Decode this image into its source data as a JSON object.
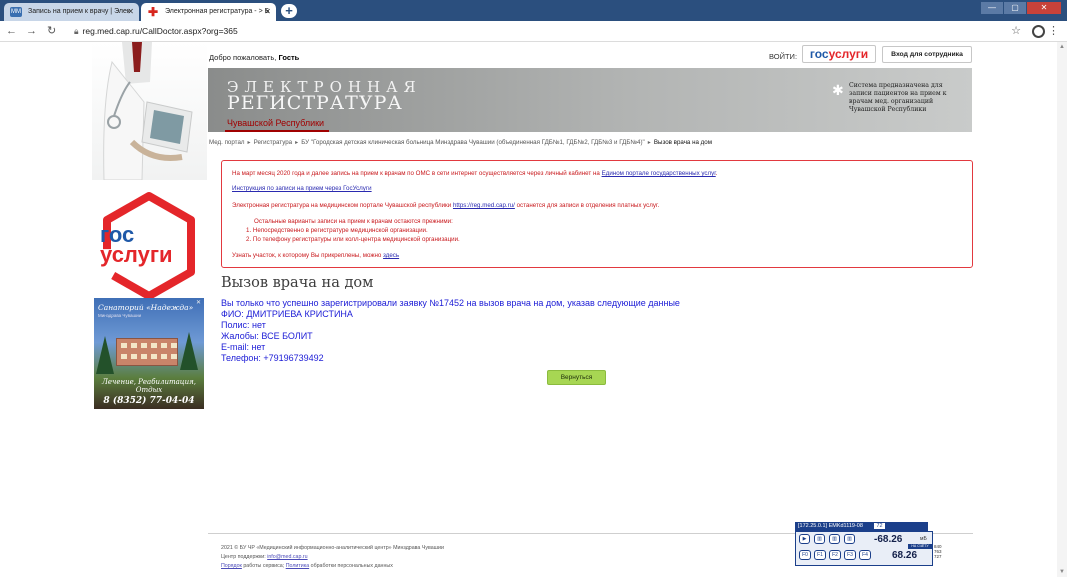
{
  "browser": {
    "tabs": [
      {
        "label": "Запись на прием к врачу | Элек",
        "icon_text": "MM"
      },
      {
        "label": "Электронная регистратура - > Б",
        "icon_text": "✚"
      }
    ],
    "new_tab_label": "+",
    "url": "reg.med.cap.ru/CallDoctor.aspx?org=365",
    "window_buttons": [
      "—",
      "▢",
      "✕"
    ]
  },
  "header": {
    "welcome_prefix": "Добро пожаловать,",
    "welcome_user": "Гость",
    "login_label": "ВОЙТИ:",
    "gosuslugi_part1": "гос",
    "gosuslugi_part2": "услуги",
    "staff_login": "Вход для сотрудника",
    "title_line1": "ЭЛЕКТРОННАЯ",
    "title_line2": "РЕГИСТРАТУРА",
    "region": "Чувашской Республики",
    "system_description": "Система предназначена для записи пациентов на прием к врачам мед. организаций Чувашской Республики"
  },
  "breadcrumb": [
    "Мед. портал",
    "Регистратура",
    "БУ \"Городская детская клиническая больница Минздрава Чувашии (объединенная ГДБ№1, ГДБ№2, ГДБ№3 и ГДБ№4)\"",
    "Вызов врача на дом"
  ],
  "notice": {
    "line1_text": "На март месяц 2020 года и далее запись на прием к врачам по ОМС в сети интернет осуществляется через личный кабинет на",
    "line1_link": "Едином портале государственных услуг",
    "line2_link": "Инструкция по записи на прием через ГосУслуги",
    "line3_text": "Электронная регистратура на медицинском портале Чувашской республики",
    "line3_link": "https://reg.med.cap.ru/",
    "line3_tail": "останется для записи в отделения платных услуг.",
    "line4": "Остальные варианты записи на прием к врачам остаются прежними:",
    "line5": "1. Непосредственно в регистратуре медицинской организации.",
    "line6": "2. По телефону регистратуры или колл-центра медицинской организации.",
    "line7_text": "Узнать участок, к которому Вы прикреплены, можно",
    "line7_link": "здесь"
  },
  "main": {
    "title": "Вызов врача на дом",
    "success": "Вы только что успешно зарегистрировали заявку №17452 на вызов врача на дом, указав следующие данные",
    "fio": "ФИО: ДМИТРИЕВА КРИСТИНА",
    "polis": "Полис: нет",
    "complaints": "Жалобы: ВСЕ БОЛИТ",
    "email": "E-mail: нет",
    "phone": "Телефон: +79196739492",
    "back_button": "Вернуться"
  },
  "sidebar": {
    "gos_logo_line1": "гос",
    "gos_logo_line2": "услуги",
    "banner_title": "Санаторий «Надежда»",
    "banner_subtitle": "Минздрава Чувашии",
    "banner_slogan_1": "Лечение, Реабилитация,",
    "banner_slogan_2": "Отдых",
    "banner_phone": "8 (8352) 77-04-04",
    "banner_close": "✕"
  },
  "footer": {
    "line1": "2021 © БУ ЧР «Медицинский информационно-аналитический центр» Минздрава Чувашии",
    "line2_text": "Центр поддержки:",
    "line2_link": "info@med.cap.ru",
    "line3_link1": "Порядок",
    "line3_text1": "работы сервиса;",
    "line3_link2": "Политика",
    "line3_text2": "обработки персональных данных"
  },
  "widget": {
    "header": "[172.25.0.1] EMKd1119-08",
    "header_tag": "72",
    "value1": "-68.26",
    "unit1": "мБ",
    "tag": "НА СЧЁТУ",
    "value2": "68.26",
    "buttons": [
      "F0",
      "F1",
      "F2",
      "F3",
      "F4"
    ],
    "side1": "840",
    "side2": "763",
    "side3": "727"
  },
  "colors": {
    "accent_red": "#c8181c",
    "link_blue": "#2a2ab0",
    "result_blue": "#1c1cd6",
    "button_green": "#a7d653",
    "gos_blue": "#1f59a8",
    "gos_red": "#e4262a"
  }
}
